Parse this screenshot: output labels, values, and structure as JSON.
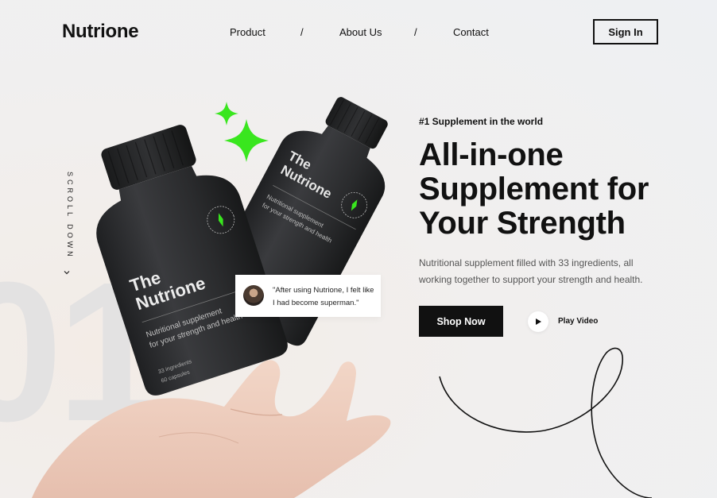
{
  "brand": {
    "name": "Nutrione"
  },
  "nav": {
    "items": [
      "Product",
      "About Us",
      "Contact"
    ],
    "separator": "/",
    "sign_in": "Sign In"
  },
  "watermark": "01",
  "scroll": {
    "label": "SCROLL DOWN",
    "icon": "chevron-down-icon"
  },
  "product": {
    "bottle_brand_line1": "The",
    "bottle_brand_line2": "Nutrione",
    "bottle_tagline_line1": "Nutritional supplement",
    "bottle_tagline_line2": "for your strength and health",
    "bottle_detail_1": "33 ingredients",
    "bottle_detail_2": "60 capsules"
  },
  "testimonial": {
    "quote": "\"After using Nutrione, I felt like I had become superman.\""
  },
  "hero": {
    "eyebrow": "#1 Supplement in the world",
    "headline": [
      "All-in-one",
      "Supplement for",
      "Your Strength"
    ],
    "description": "Nutritional supplement filled with 33 ingredients, all working together to support your strength and  health.",
    "cta": "Shop Now",
    "video_label": "Play Video"
  },
  "colors": {
    "accent_green": "#39e61e",
    "bottle": "#2b2c2e",
    "text": "#111111"
  }
}
